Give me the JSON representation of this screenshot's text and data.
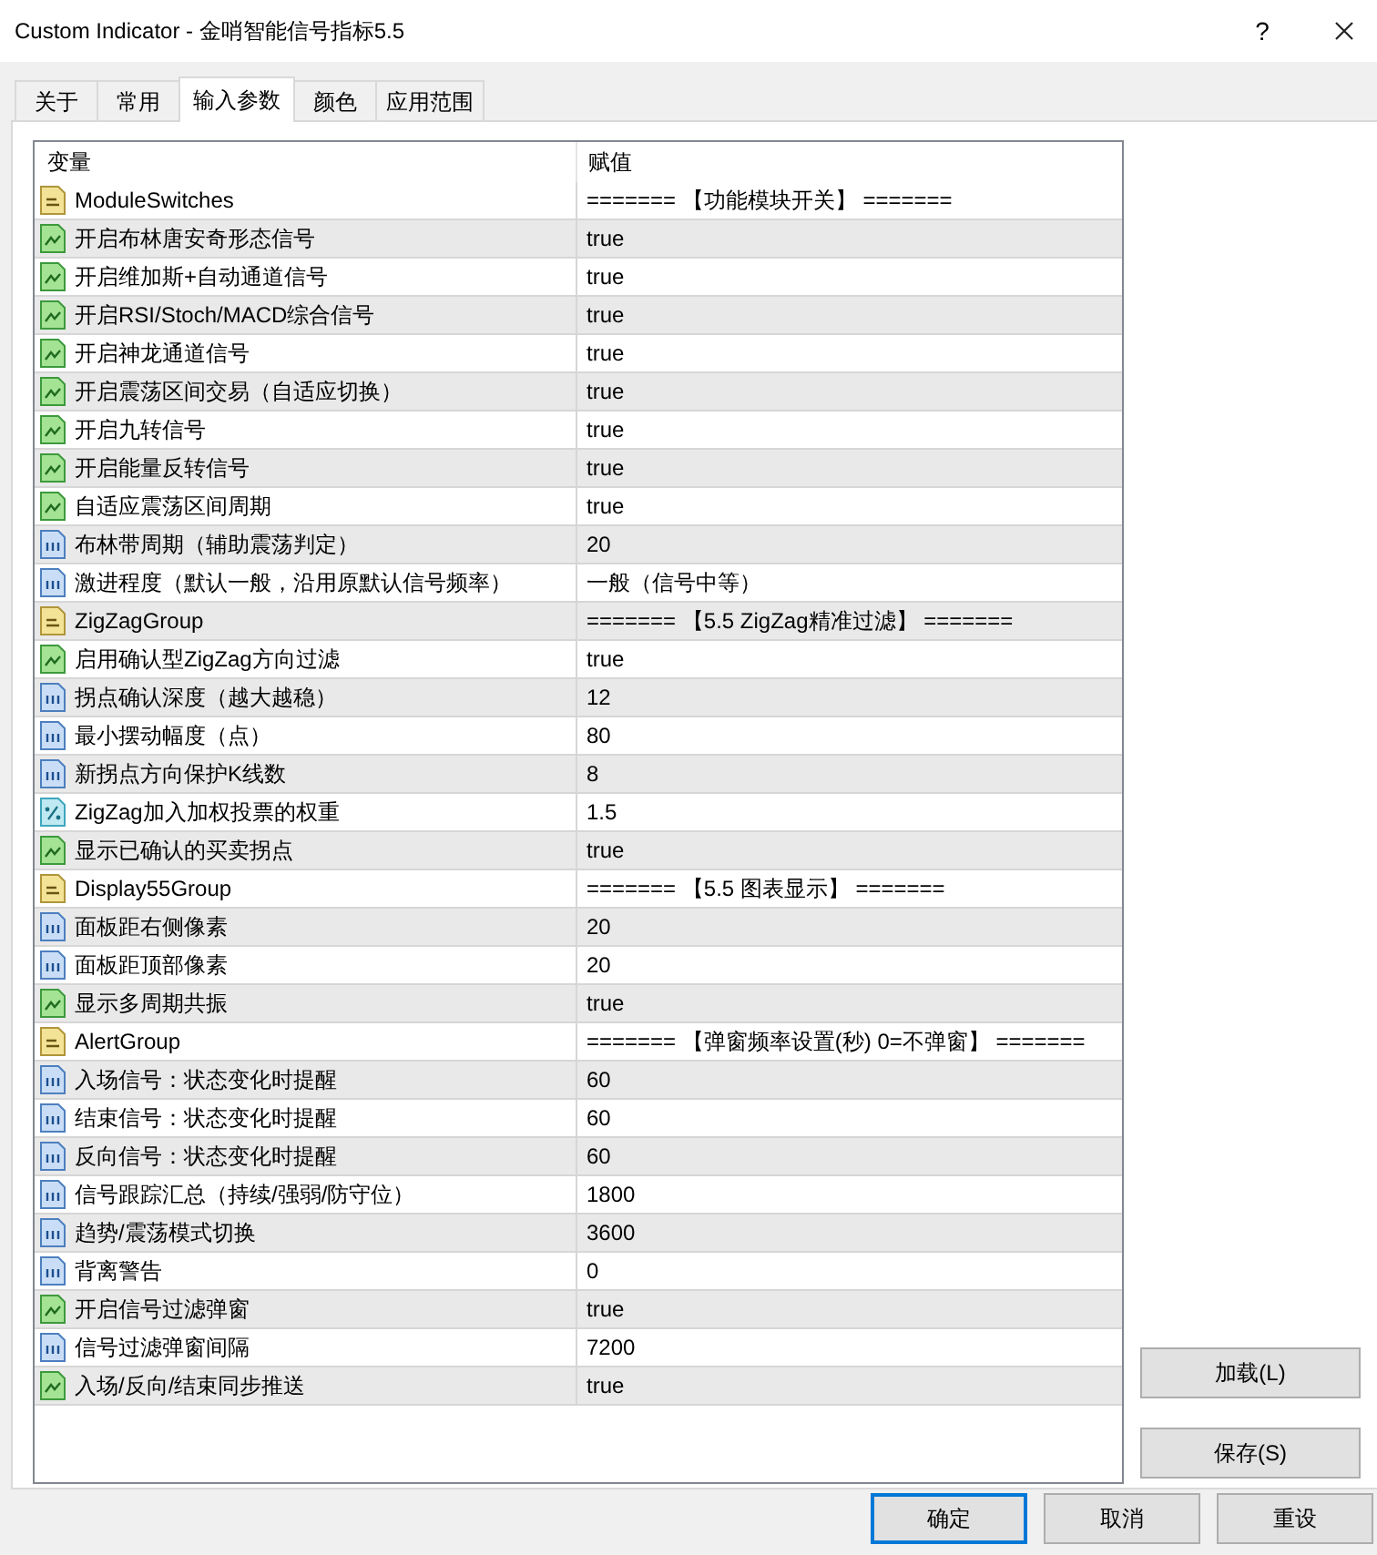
{
  "window": {
    "title": "Custom Indicator - 金哨智能信号指标5.5",
    "help": "?"
  },
  "tabs": [
    {
      "label": "关于",
      "selected": false
    },
    {
      "label": "常用",
      "selected": false
    },
    {
      "label": "输入参数",
      "selected": true
    },
    {
      "label": "颜色",
      "selected": false
    },
    {
      "label": "应用范围",
      "selected": false
    }
  ],
  "parameters": {
    "columns": [
      "变量",
      "赋值"
    ],
    "rows": [
      {
        "kind": "string",
        "name": "ModuleSwitches",
        "value": "======= 【功能模块开关】 ======="
      },
      {
        "kind": "bool",
        "name": "开启布林唐安奇形态信号",
        "value": "true"
      },
      {
        "kind": "bool",
        "name": "开启维加斯+自动通道信号",
        "value": "true"
      },
      {
        "kind": "bool",
        "name": "开启RSI/Stoch/MACD综合信号",
        "value": "true"
      },
      {
        "kind": "bool",
        "name": "开启神龙通道信号",
        "value": "true"
      },
      {
        "kind": "bool",
        "name": "开启震荡区间交易（自适应切换）",
        "value": "true"
      },
      {
        "kind": "bool",
        "name": "开启九转信号",
        "value": "true"
      },
      {
        "kind": "bool",
        "name": "开启能量反转信号",
        "value": "true"
      },
      {
        "kind": "bool",
        "name": "自适应震荡区间周期",
        "value": "true"
      },
      {
        "kind": "int",
        "name": "布林带周期（辅助震荡判定）",
        "value": "20"
      },
      {
        "kind": "int",
        "name": "激进程度（默认一般，沿用原默认信号频率）",
        "value": "一般（信号中等）"
      },
      {
        "kind": "string",
        "name": "ZigZagGroup",
        "value": "======= 【5.5 ZigZag精准过滤】 ======="
      },
      {
        "kind": "bool",
        "name": "启用确认型ZigZag方向过滤",
        "value": "true"
      },
      {
        "kind": "int",
        "name": "拐点确认深度（越大越稳）",
        "value": "12"
      },
      {
        "kind": "int",
        "name": "最小摆动幅度（点）",
        "value": "80"
      },
      {
        "kind": "int",
        "name": "新拐点方向保护K线数",
        "value": "8"
      },
      {
        "kind": "double",
        "name": "ZigZag加入加权投票的权重",
        "value": "1.5"
      },
      {
        "kind": "bool",
        "name": "显示已确认的买卖拐点",
        "value": "true"
      },
      {
        "kind": "string",
        "name": "Display55Group",
        "value": "======= 【5.5 图表显示】 ======="
      },
      {
        "kind": "int",
        "name": "面板距右侧像素",
        "value": "20"
      },
      {
        "kind": "int",
        "name": "面板距顶部像素",
        "value": "20"
      },
      {
        "kind": "bool",
        "name": "显示多周期共振",
        "value": "true"
      },
      {
        "kind": "string",
        "name": "AlertGroup",
        "value": "======= 【弹窗频率设置(秒) 0=不弹窗】 ======="
      },
      {
        "kind": "int",
        "name": "入场信号：状态变化时提醒",
        "value": "60"
      },
      {
        "kind": "int",
        "name": "结束信号：状态变化时提醒",
        "value": "60"
      },
      {
        "kind": "int",
        "name": "反向信号：状态变化时提醒",
        "value": "60"
      },
      {
        "kind": "int",
        "name": "信号跟踪汇总（持续/强弱/防守位）",
        "value": "1800"
      },
      {
        "kind": "int",
        "name": "趋势/震荡模式切换",
        "value": "3600"
      },
      {
        "kind": "int",
        "name": "背离警告",
        "value": "0"
      },
      {
        "kind": "bool",
        "name": "开启信号过滤弹窗",
        "value": "true"
      },
      {
        "kind": "int",
        "name": "信号过滤弹窗间隔",
        "value": "7200"
      },
      {
        "kind": "bool",
        "name": "入场/反向/结束同步推送",
        "value": "true"
      }
    ]
  },
  "side_buttons": [
    {
      "label": "加载(L)"
    },
    {
      "label": "保存(S)"
    }
  ],
  "buttons": [
    {
      "label": "确定",
      "focused": true
    },
    {
      "label": "取消",
      "focused": false
    },
    {
      "label": "重设",
      "focused": false
    }
  ]
}
